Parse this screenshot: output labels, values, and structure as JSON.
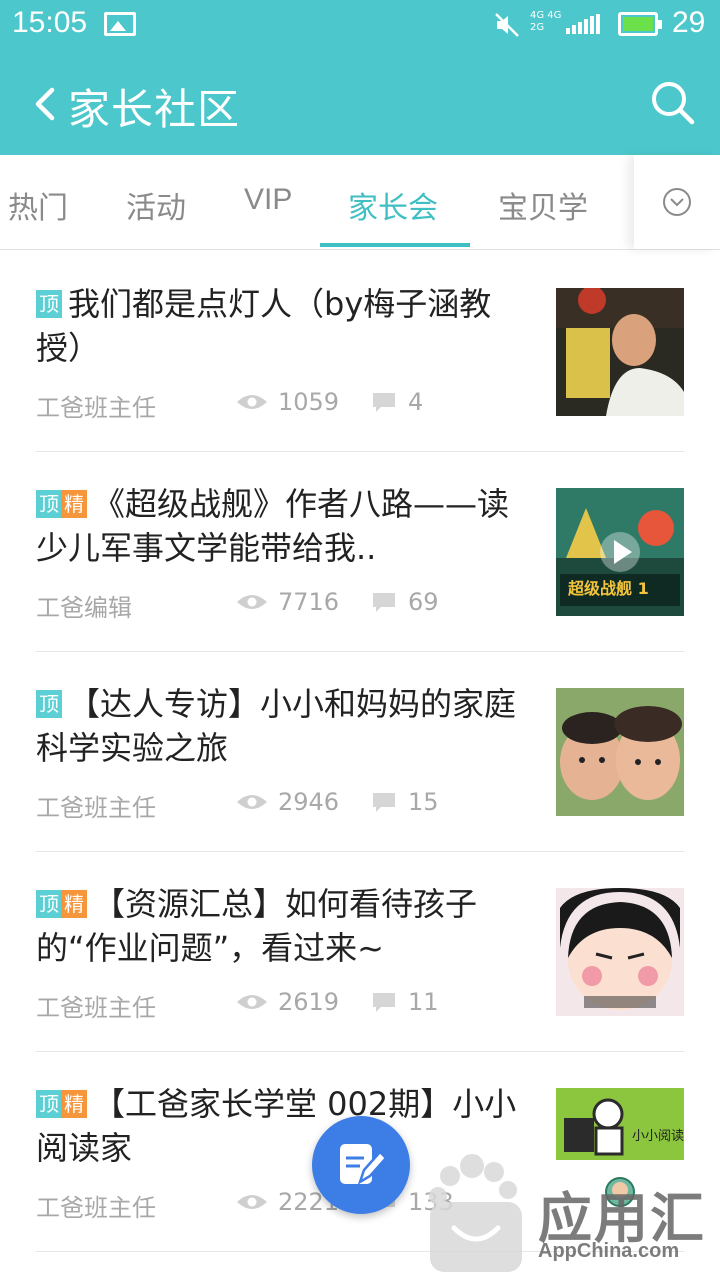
{
  "status_bar": {
    "time": "15:05",
    "battery": "29",
    "network": "4G 4G\n2G"
  },
  "header": {
    "title": "家长社区"
  },
  "tabs": [
    {
      "label": "热门"
    },
    {
      "label": "活动"
    },
    {
      "label": "VIP"
    },
    {
      "label": "家长会",
      "active": true
    },
    {
      "label": "宝贝学"
    }
  ],
  "badges": {
    "top": "顶",
    "featured": "精"
  },
  "feed": [
    {
      "title": "我们都是点灯人（by梅子涵教授）",
      "author": "工爸班主任",
      "views": "1059",
      "comments": "4",
      "featured": false
    },
    {
      "title": "《超级战舰》作者八路——读少儿军事文学能带给我..",
      "author": "工爸编辑",
      "views": "7716",
      "comments": "69",
      "featured": true
    },
    {
      "title": "【达人专访】小小和妈妈的家庭科学实验之旅",
      "author": "工爸班主任",
      "views": "2946",
      "comments": "15",
      "featured": false
    },
    {
      "title": "【资源汇总】如何看待孩子的“作业问题”，看过来~",
      "author": "工爸班主任",
      "views": "2619",
      "comments": "11",
      "featured": true
    },
    {
      "title": "【工爸家长学堂 002期】小小阅读家",
      "author": "工爸班主任",
      "views": "222117",
      "comments": "133",
      "featured": true
    }
  ],
  "thumb_texts": {
    "thumb2": "超级战舰 1",
    "thumb5": "小小阅读"
  },
  "watermark": {
    "name": "应用汇",
    "site": "AppChina.com"
  },
  "colors": {
    "primary": "#4cc8cc",
    "accent": "#3fbfc2",
    "featured": "#f6953a",
    "fab": "#3c7de6"
  }
}
